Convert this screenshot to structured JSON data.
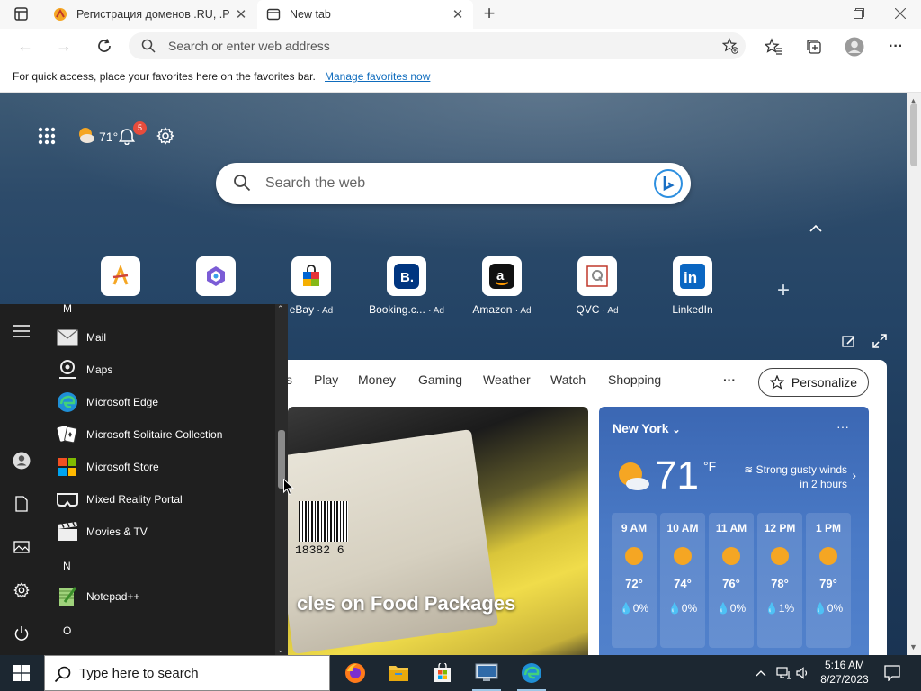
{
  "browser": {
    "tabs": [
      {
        "title": "Регистрация доменов .RU, .РФ",
        "active": false
      },
      {
        "title": "New tab",
        "active": true
      }
    ],
    "address_placeholder": "Search or enter web address",
    "favorites_bar_message": "For quick access, place your favorites here on the favorites bar.",
    "favorites_bar_link": "Manage favorites now"
  },
  "ntp": {
    "weather_temp": "71°",
    "notification_count": "5",
    "search_placeholder": "Search the web",
    "quick_links": [
      {
        "label": "",
        "ad": ""
      },
      {
        "label": "",
        "ad": ""
      },
      {
        "label": "eBay",
        "ad": "· Ad"
      },
      {
        "label": "Booking.c...",
        "ad": "· Ad"
      },
      {
        "label": "Amazon",
        "ad": "· Ad"
      },
      {
        "label": "QVC",
        "ad": "· Ad"
      },
      {
        "label": "LinkedIn",
        "ad": ""
      }
    ],
    "feed_nav": [
      "s",
      "Play",
      "Money",
      "Gaming",
      "Weather",
      "Watch",
      "Shopping",
      "···"
    ],
    "personalize_label": "Personalize",
    "news_headline": "cles on Food Packages",
    "news_image_text": "18382  6",
    "weather": {
      "location": "New York",
      "temp": "71",
      "unit": "°F",
      "wind_line1": "Strong gusty winds",
      "wind_line2": "in 2 hours",
      "more": "···",
      "hours": [
        {
          "time": "9 AM",
          "temp": "72°",
          "precip": "0%"
        },
        {
          "time": "10 AM",
          "temp": "74°",
          "precip": "0%"
        },
        {
          "time": "11 AM",
          "temp": "76°",
          "precip": "0%"
        },
        {
          "time": "12 PM",
          "temp": "78°",
          "precip": "1%"
        },
        {
          "time": "1 PM",
          "temp": "79°",
          "precip": "0%"
        }
      ]
    }
  },
  "start_menu": {
    "letters": {
      "m": "M",
      "n": "N",
      "o": "O"
    },
    "apps": [
      {
        "name": "Mail"
      },
      {
        "name": "Maps"
      },
      {
        "name": "Microsoft Edge"
      },
      {
        "name": "Microsoft Solitaire Collection"
      },
      {
        "name": "Microsoft Store"
      },
      {
        "name": "Mixed Reality Portal"
      },
      {
        "name": "Movies & TV"
      },
      {
        "name": "Notepad++"
      }
    ]
  },
  "taskbar": {
    "search_placeholder": "Type here to search",
    "time": "5:16 AM",
    "date": "8/27/2023"
  },
  "colors": {
    "accent_link": "#0f6cbd",
    "taskbar": "#1c2731",
    "start_menu": "#1f1f1f",
    "weather_card": "#4a7ac6",
    "notification_badge": "#e74c3c"
  }
}
